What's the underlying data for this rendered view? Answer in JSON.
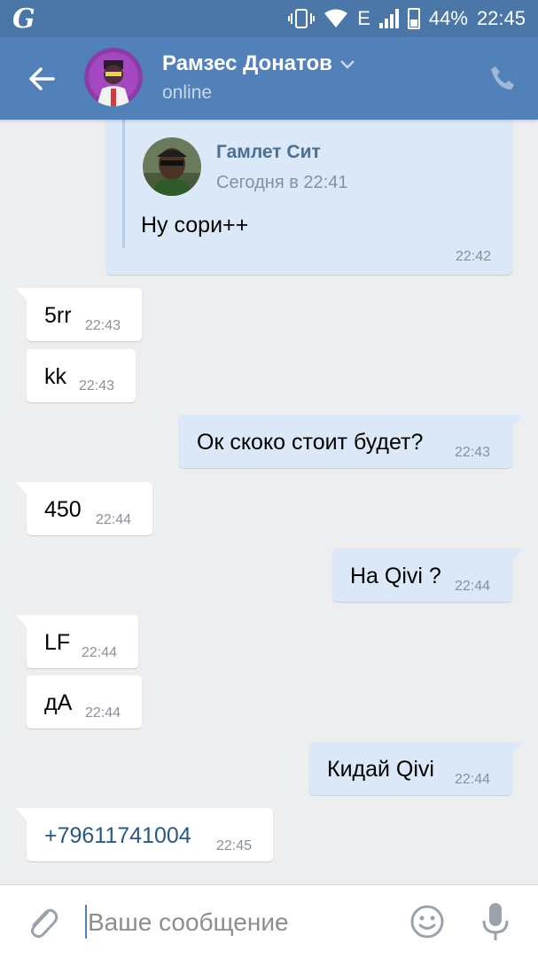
{
  "status_bar": {
    "logo": "G",
    "network": "E",
    "battery": "44%",
    "time": "22:45"
  },
  "header": {
    "name": "Рамзес Донатов",
    "status": "online"
  },
  "forwarded": {
    "author": "Гамлет Сит",
    "date": "Сегодня в 22:41",
    "text": "Ну сори++",
    "time": "22:42"
  },
  "messages": [
    {
      "text": "5rr",
      "time": "22:43"
    },
    {
      "text": "kk",
      "time": "22:43"
    },
    {
      "text": "Ок скоко стоит будет?",
      "time": "22:43"
    },
    {
      "text": "450",
      "time": "22:44"
    },
    {
      "text": "На Qivi ?",
      "time": "22:44"
    },
    {
      "text": "LF",
      "time": "22:44"
    },
    {
      "text": "дА",
      "time": "22:44"
    },
    {
      "text": "Кидай Qivi",
      "time": "22:44"
    },
    {
      "text": "+79611741004",
      "time": "22:45"
    }
  ],
  "input": {
    "placeholder": "Ваше сообщение"
  },
  "colors": {
    "accent": "#5181b8",
    "outgoing_bubble": "#dbe8f7",
    "incoming_bubble": "#ffffff",
    "background": "#edeef0"
  },
  "icons": [
    "back-arrow-icon",
    "chevron-down-icon",
    "phone-icon",
    "paperclip-icon",
    "emoji-icon",
    "microphone-icon"
  ]
}
